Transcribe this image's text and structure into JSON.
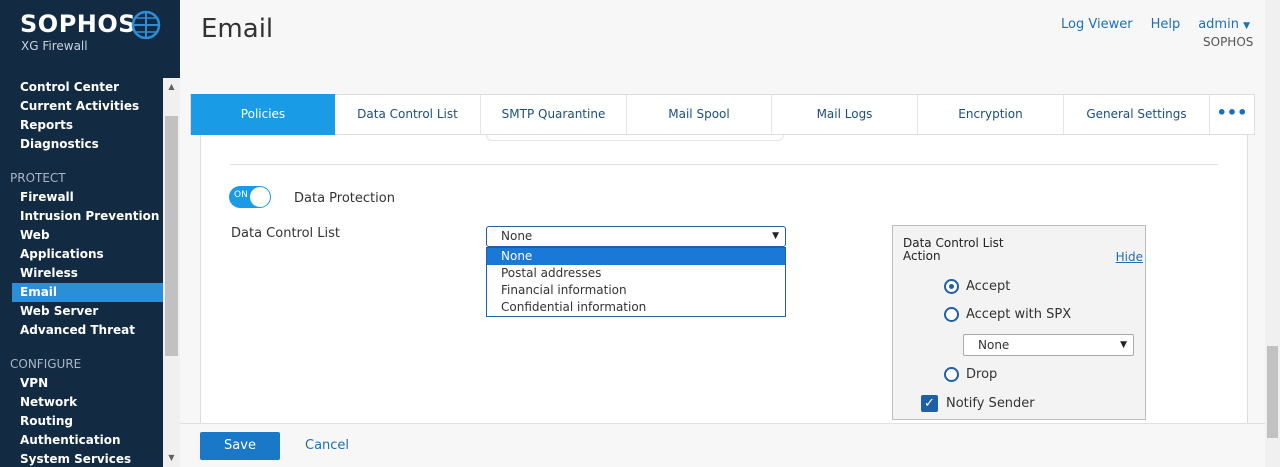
{
  "brand": {
    "name": "SOPHOS",
    "product": "XG Firewall"
  },
  "sidebar": {
    "top_items": [
      "Control Center",
      "Current Activities",
      "Reports",
      "Diagnostics"
    ],
    "protect_title": "PROTECT",
    "protect_items": [
      "Firewall",
      "Intrusion Prevention",
      "Web",
      "Applications",
      "Wireless",
      "Email",
      "Web Server",
      "Advanced Threat"
    ],
    "configure_title": "CONFIGURE",
    "configure_items": [
      "VPN",
      "Network",
      "Routing",
      "Authentication",
      "System Services"
    ],
    "active_item": "Email"
  },
  "header": {
    "title": "Email",
    "log_viewer": "Log Viewer",
    "help": "Help",
    "user": "admin",
    "org": "SOPHOS"
  },
  "tabs": [
    {
      "label": "Policies",
      "active": true
    },
    {
      "label": "Data Control List",
      "active": false
    },
    {
      "label": "SMTP Quarantine",
      "active": false
    },
    {
      "label": "Mail Spool",
      "active": false
    },
    {
      "label": "Mail Logs",
      "active": false
    },
    {
      "label": "Encryption",
      "active": false
    },
    {
      "label": "General Settings",
      "active": false
    }
  ],
  "tabs_more": "•••",
  "form": {
    "toggle_state": "ON",
    "data_protection_label": "Data Protection",
    "dcl_label": "Data Control List",
    "dcl_selected": "None",
    "dcl_options": [
      "None",
      "Postal addresses",
      "Financial information",
      "Confidential information"
    ]
  },
  "action": {
    "title": "Data Control List Action",
    "hide": "Hide",
    "accept": "Accept",
    "accept_spx": "Accept with SPX",
    "spx_selected": "None",
    "drop": "Drop",
    "notify_sender": "Notify Sender",
    "selected": "Accept",
    "notify_checked": true
  },
  "footer": {
    "save": "Save",
    "cancel": "Cancel"
  },
  "colors": {
    "sidebar_bg": "#122a42",
    "accent": "#1a9be6",
    "active_nav": "#2b8ed8",
    "link": "#1d6fb8"
  }
}
